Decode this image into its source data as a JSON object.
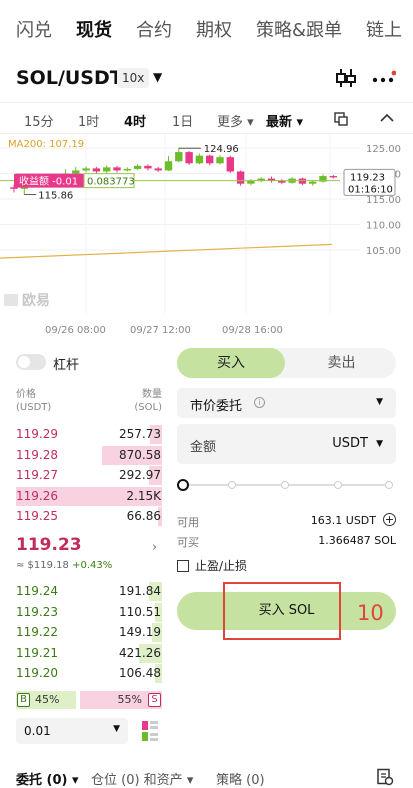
{
  "top_tabs": [
    "闪兑",
    "现货",
    "合约",
    "期权",
    "策略&跟单",
    "链上"
  ],
  "header": {
    "pair": "SOL/USDT",
    "leverage": "10x"
  },
  "timeframes": {
    "items": [
      "15分",
      "1时",
      "4时",
      "1日",
      "更多 ▾",
      "最新 ▾"
    ],
    "active": "4时"
  },
  "chart": {
    "ma_label": "MA200: 107.19",
    "high_label": "124.96",
    "low_label": "115.86",
    "pnl_label": "收益额 -0.01",
    "entry_price": "0.083773",
    "current_price": "119.23",
    "countdown": "01:16:10",
    "watermark": "欧易",
    "y_ticks": [
      "125.00",
      "120.00",
      "115.00",
      "110.00",
      "105.00"
    ],
    "x_ticks": [
      "09/26 08:00",
      "09/27 12:00",
      "09/28 16:00"
    ],
    "colors": {
      "up": "#6bbd2a",
      "down": "#e8388a",
      "ma": "#e0b24a"
    }
  },
  "margin": {
    "label": "杠杆"
  },
  "orderbook": {
    "price_head": "价格\n(USDT)",
    "qty_head": "数量\n(SOL)",
    "asks": [
      {
        "price": "119.29",
        "qty": "257.73",
        "depth": 0.08
      },
      {
        "price": "119.28",
        "qty": "870.58",
        "depth": 0.41
      },
      {
        "price": "119.27",
        "qty": "292.97",
        "depth": 0.09
      },
      {
        "price": "119.26",
        "qty": "2.15K",
        "depth": 1.0
      },
      {
        "price": "119.25",
        "qty": "66.86",
        "depth": 0.03
      }
    ],
    "last_price": "119.23",
    "last_usd": "≈ $119.18",
    "last_change": "+0.43%",
    "bids": [
      {
        "price": "119.24",
        "qty": "191.84",
        "depth": 0.09
      },
      {
        "price": "119.23",
        "qty": "110.51",
        "depth": 0.05
      },
      {
        "price": "119.22",
        "qty": "149.19",
        "depth": 0.07
      },
      {
        "price": "119.21",
        "qty": "421.26",
        "depth": 0.16
      },
      {
        "price": "119.20",
        "qty": "106.48",
        "depth": 0.05
      }
    ],
    "buy_ratio_badge": "B",
    "buy_ratio": "45%",
    "sell_ratio": "55%",
    "sell_ratio_badge": "S",
    "depth_value": "0.01"
  },
  "order_form": {
    "buy_tab": "买入",
    "sell_tab": "卖出",
    "order_type": "市价委托",
    "amount_label": "金额",
    "amount_unit": "USDT",
    "available_label": "可用",
    "available_value": "163.1 USDT",
    "buyable_label": "可买",
    "buyable_value": "1.366487 SOL",
    "tpsl_label": "止盈/止损",
    "submit_label": "买入 SOL",
    "annotation_number": "10"
  },
  "bottom_tabs": [
    "委托 (0)",
    "仓位 (0) 和资产",
    "策略 (0)"
  ]
}
